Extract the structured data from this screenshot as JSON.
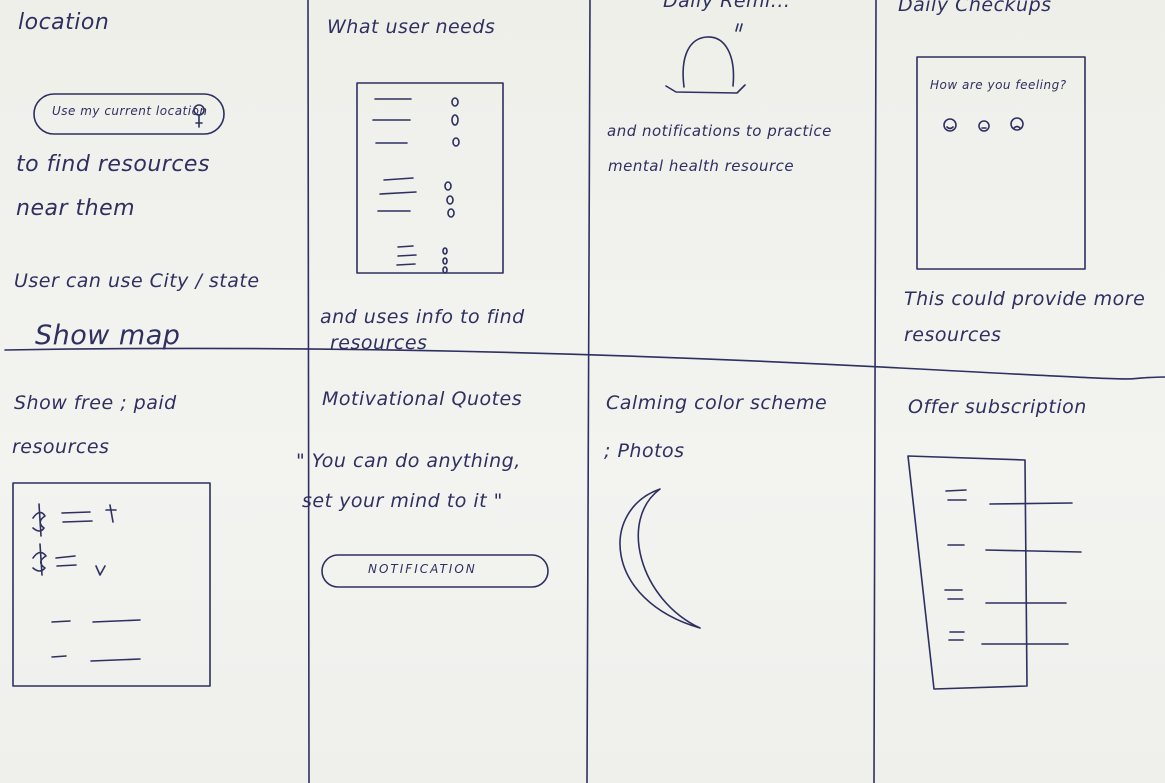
{
  "panels": {
    "p1": {
      "title": "location",
      "button_label": "Use my current location",
      "line1": "to find resources",
      "line2": "near them",
      "line3": "User can use City / state",
      "line4": "Show map"
    },
    "p2": {
      "title": "What user needs",
      "caption_line1": "and uses info to find",
      "caption_line2": "resources"
    },
    "p3": {
      "top": "Daily Remi...",
      "caption_line1": "and notifications to practice",
      "caption_line2": "mental health resource"
    },
    "p4": {
      "title": "Daily Checkups",
      "prompt": "How are you feeling?",
      "caption_line1": "This could provide more",
      "caption_line2": "resources"
    },
    "p5": {
      "title": "Show free ; paid",
      "title2": "resources"
    },
    "p6": {
      "title": "Motivational Quotes",
      "quote_line1": "\" You can do anything,",
      "quote_line2": "set your mind to it \"",
      "button_label": "NOTIFICATION"
    },
    "p7": {
      "title": "Calming color scheme",
      "title2": "; Photos"
    },
    "p8": {
      "title": "Offer subscription"
    }
  },
  "icons": [
    "map-pin-icon",
    "bell-icon",
    "smiley-face-icon",
    "neutral-face-icon",
    "sad-face-icon",
    "dollar-icon",
    "crescent-moon-icon"
  ]
}
